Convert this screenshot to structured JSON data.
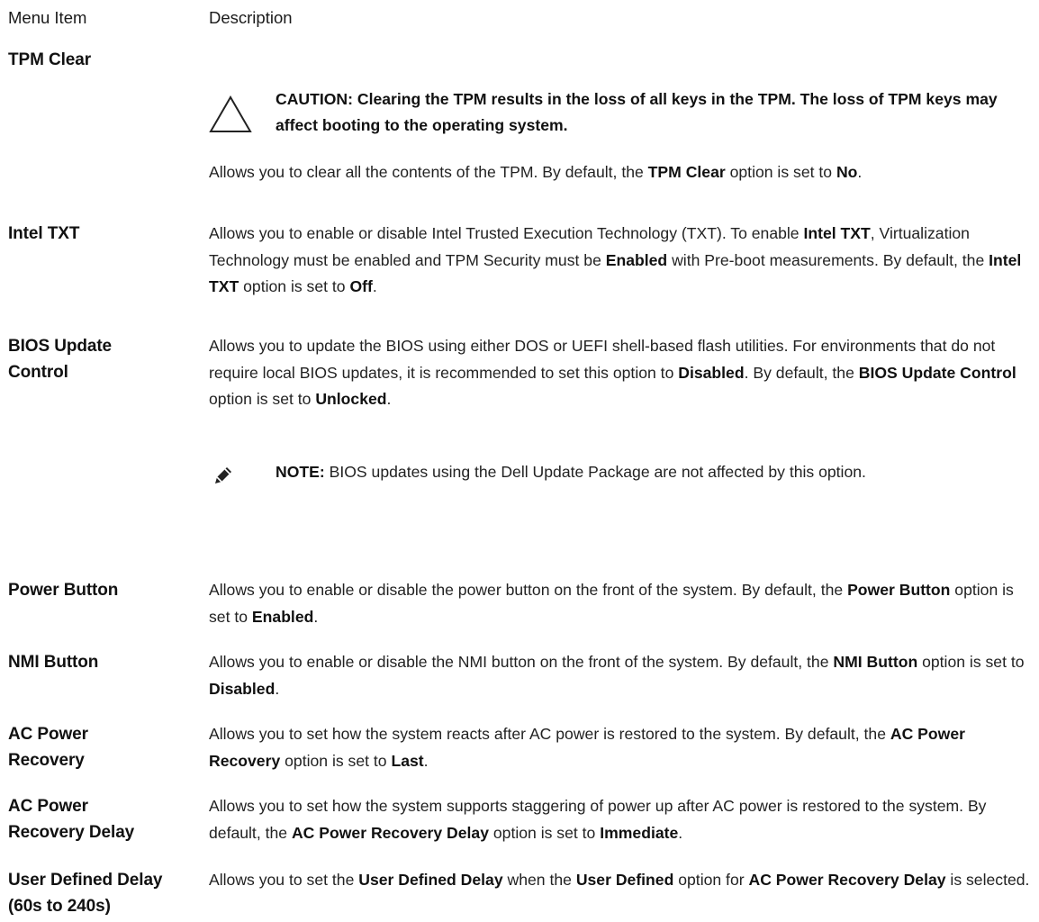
{
  "table": {
    "header": {
      "menu_item": "Menu Item",
      "description": "Description"
    },
    "tpm_clear": {
      "label": "TPM Clear",
      "caution_icon": "warning-triangle-icon",
      "caution_text": "CAUTION: Clearing the TPM results in the loss of all keys in the TPM. The loss of TPM keys may affect booting to the operating system.",
      "desc": [
        "Allows you to clear all the contents of the TPM. By default, the ",
        "TPM Clear",
        " option is set to ",
        "No",
        "."
      ]
    },
    "intel_txt": {
      "label": "Intel TXT",
      "desc": [
        "Allows you to enable or disable Intel Trusted Execution Technology (TXT). To enable ",
        "Intel TXT",
        ", Virtualization Technology must be enabled and TPM Security must be ",
        "Enabled",
        " with Pre-boot measurements. By default, the ",
        "Intel TXT",
        " option is set to ",
        "Off",
        "."
      ]
    },
    "bios_update": {
      "label_line1": "BIOS Update",
      "label_line2": "Control",
      "desc": [
        "Allows you to update the BIOS using either DOS or UEFI shell-based flash utilities. For environments that do not require local BIOS updates, it is recommended to set this option to ",
        "Disabled",
        ". By default, the ",
        "BIOS Update Control",
        " option is set to ",
        "Unlocked",
        "."
      ],
      "note_icon": "pencil-note-icon",
      "note_label": "NOTE:",
      "note_text": " BIOS updates using the Dell Update Package are not affected by this option."
    },
    "power_button": {
      "label": "Power Button",
      "desc": [
        "Allows you to enable or disable the power button on the front of the system. By default, the ",
        "Power Button",
        " option is set to ",
        "Enabled",
        "."
      ]
    },
    "nmi_button": {
      "label": "NMI Button",
      "desc": [
        "Allows you to enable or disable the NMI button on the front of the system. By default, the ",
        "NMI Button",
        " option is set to ",
        "Disabled",
        "."
      ]
    },
    "ac_power_recovery": {
      "label_line1": "AC Power",
      "label_line2": "Recovery",
      "desc": [
        "Allows you to set how the system reacts after AC power is restored to the system. By default, the ",
        "AC Power Recovery",
        " option is set to ",
        "Last",
        "."
      ]
    },
    "ac_power_recovery_delay": {
      "label_line1": "AC Power",
      "label_line2": "Recovery Delay",
      "desc": [
        "Allows you to set how the system supports staggering of power up after AC power is restored to the system. By default, the ",
        "AC Power Recovery Delay",
        " option is set to ",
        "Immediate",
        "."
      ]
    },
    "user_defined_delay": {
      "label_line1": "User Defined Delay",
      "label_line2": "(60s to 240s)",
      "desc": [
        "Allows you to set the ",
        "User Defined Delay",
        " when the ",
        "User Defined",
        " option for ",
        "AC Power Recovery Delay",
        " is selected."
      ]
    }
  }
}
